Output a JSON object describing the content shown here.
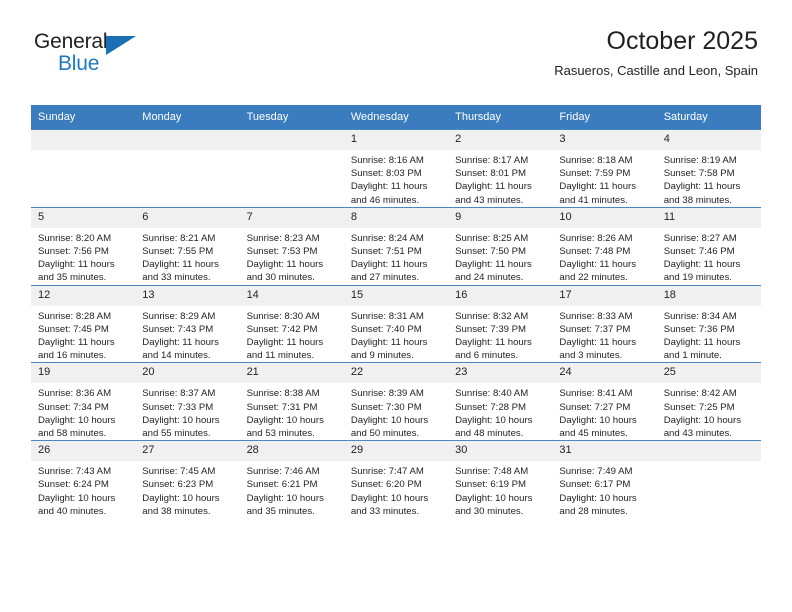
{
  "brand": {
    "name_part1": "General",
    "name_part2": "Blue"
  },
  "header": {
    "title": "October 2025",
    "subtitle": "Rasueros, Castille and Leon, Spain"
  },
  "calendar": {
    "weekday_headers": [
      "Sunday",
      "Monday",
      "Tuesday",
      "Wednesday",
      "Thursday",
      "Friday",
      "Saturday"
    ],
    "accent_color": "#3a7cbe",
    "daynum_bg": "#f0f0f0",
    "weeks": [
      [
        {
          "day": "",
          "empty": true,
          "sunrise": "",
          "sunset": "",
          "daylight1": "",
          "daylight2": ""
        },
        {
          "day": "",
          "empty": true,
          "sunrise": "",
          "sunset": "",
          "daylight1": "",
          "daylight2": ""
        },
        {
          "day": "",
          "empty": true,
          "sunrise": "",
          "sunset": "",
          "daylight1": "",
          "daylight2": ""
        },
        {
          "day": "1",
          "empty": false,
          "sunrise": "Sunrise: 8:16 AM",
          "sunset": "Sunset: 8:03 PM",
          "daylight1": "Daylight: 11 hours",
          "daylight2": "and 46 minutes."
        },
        {
          "day": "2",
          "empty": false,
          "sunrise": "Sunrise: 8:17 AM",
          "sunset": "Sunset: 8:01 PM",
          "daylight1": "Daylight: 11 hours",
          "daylight2": "and 43 minutes."
        },
        {
          "day": "3",
          "empty": false,
          "sunrise": "Sunrise: 8:18 AM",
          "sunset": "Sunset: 7:59 PM",
          "daylight1": "Daylight: 11 hours",
          "daylight2": "and 41 minutes."
        },
        {
          "day": "4",
          "empty": false,
          "sunrise": "Sunrise: 8:19 AM",
          "sunset": "Sunset: 7:58 PM",
          "daylight1": "Daylight: 11 hours",
          "daylight2": "and 38 minutes."
        }
      ],
      [
        {
          "day": "5",
          "empty": false,
          "sunrise": "Sunrise: 8:20 AM",
          "sunset": "Sunset: 7:56 PM",
          "daylight1": "Daylight: 11 hours",
          "daylight2": "and 35 minutes."
        },
        {
          "day": "6",
          "empty": false,
          "sunrise": "Sunrise: 8:21 AM",
          "sunset": "Sunset: 7:55 PM",
          "daylight1": "Daylight: 11 hours",
          "daylight2": "and 33 minutes."
        },
        {
          "day": "7",
          "empty": false,
          "sunrise": "Sunrise: 8:23 AM",
          "sunset": "Sunset: 7:53 PM",
          "daylight1": "Daylight: 11 hours",
          "daylight2": "and 30 minutes."
        },
        {
          "day": "8",
          "empty": false,
          "sunrise": "Sunrise: 8:24 AM",
          "sunset": "Sunset: 7:51 PM",
          "daylight1": "Daylight: 11 hours",
          "daylight2": "and 27 minutes."
        },
        {
          "day": "9",
          "empty": false,
          "sunrise": "Sunrise: 8:25 AM",
          "sunset": "Sunset: 7:50 PM",
          "daylight1": "Daylight: 11 hours",
          "daylight2": "and 24 minutes."
        },
        {
          "day": "10",
          "empty": false,
          "sunrise": "Sunrise: 8:26 AM",
          "sunset": "Sunset: 7:48 PM",
          "daylight1": "Daylight: 11 hours",
          "daylight2": "and 22 minutes."
        },
        {
          "day": "11",
          "empty": false,
          "sunrise": "Sunrise: 8:27 AM",
          "sunset": "Sunset: 7:46 PM",
          "daylight1": "Daylight: 11 hours",
          "daylight2": "and 19 minutes."
        }
      ],
      [
        {
          "day": "12",
          "empty": false,
          "sunrise": "Sunrise: 8:28 AM",
          "sunset": "Sunset: 7:45 PM",
          "daylight1": "Daylight: 11 hours",
          "daylight2": "and 16 minutes."
        },
        {
          "day": "13",
          "empty": false,
          "sunrise": "Sunrise: 8:29 AM",
          "sunset": "Sunset: 7:43 PM",
          "daylight1": "Daylight: 11 hours",
          "daylight2": "and 14 minutes."
        },
        {
          "day": "14",
          "empty": false,
          "sunrise": "Sunrise: 8:30 AM",
          "sunset": "Sunset: 7:42 PM",
          "daylight1": "Daylight: 11 hours",
          "daylight2": "and 11 minutes."
        },
        {
          "day": "15",
          "empty": false,
          "sunrise": "Sunrise: 8:31 AM",
          "sunset": "Sunset: 7:40 PM",
          "daylight1": "Daylight: 11 hours",
          "daylight2": "and 9 minutes."
        },
        {
          "day": "16",
          "empty": false,
          "sunrise": "Sunrise: 8:32 AM",
          "sunset": "Sunset: 7:39 PM",
          "daylight1": "Daylight: 11 hours",
          "daylight2": "and 6 minutes."
        },
        {
          "day": "17",
          "empty": false,
          "sunrise": "Sunrise: 8:33 AM",
          "sunset": "Sunset: 7:37 PM",
          "daylight1": "Daylight: 11 hours",
          "daylight2": "and 3 minutes."
        },
        {
          "day": "18",
          "empty": false,
          "sunrise": "Sunrise: 8:34 AM",
          "sunset": "Sunset: 7:36 PM",
          "daylight1": "Daylight: 11 hours",
          "daylight2": "and 1 minute."
        }
      ],
      [
        {
          "day": "19",
          "empty": false,
          "sunrise": "Sunrise: 8:36 AM",
          "sunset": "Sunset: 7:34 PM",
          "daylight1": "Daylight: 10 hours",
          "daylight2": "and 58 minutes."
        },
        {
          "day": "20",
          "empty": false,
          "sunrise": "Sunrise: 8:37 AM",
          "sunset": "Sunset: 7:33 PM",
          "daylight1": "Daylight: 10 hours",
          "daylight2": "and 55 minutes."
        },
        {
          "day": "21",
          "empty": false,
          "sunrise": "Sunrise: 8:38 AM",
          "sunset": "Sunset: 7:31 PM",
          "daylight1": "Daylight: 10 hours",
          "daylight2": "and 53 minutes."
        },
        {
          "day": "22",
          "empty": false,
          "sunrise": "Sunrise: 8:39 AM",
          "sunset": "Sunset: 7:30 PM",
          "daylight1": "Daylight: 10 hours",
          "daylight2": "and 50 minutes."
        },
        {
          "day": "23",
          "empty": false,
          "sunrise": "Sunrise: 8:40 AM",
          "sunset": "Sunset: 7:28 PM",
          "daylight1": "Daylight: 10 hours",
          "daylight2": "and 48 minutes."
        },
        {
          "day": "24",
          "empty": false,
          "sunrise": "Sunrise: 8:41 AM",
          "sunset": "Sunset: 7:27 PM",
          "daylight1": "Daylight: 10 hours",
          "daylight2": "and 45 minutes."
        },
        {
          "day": "25",
          "empty": false,
          "sunrise": "Sunrise: 8:42 AM",
          "sunset": "Sunset: 7:25 PM",
          "daylight1": "Daylight: 10 hours",
          "daylight2": "and 43 minutes."
        }
      ],
      [
        {
          "day": "26",
          "empty": false,
          "sunrise": "Sunrise: 7:43 AM",
          "sunset": "Sunset: 6:24 PM",
          "daylight1": "Daylight: 10 hours",
          "daylight2": "and 40 minutes."
        },
        {
          "day": "27",
          "empty": false,
          "sunrise": "Sunrise: 7:45 AM",
          "sunset": "Sunset: 6:23 PM",
          "daylight1": "Daylight: 10 hours",
          "daylight2": "and 38 minutes."
        },
        {
          "day": "28",
          "empty": false,
          "sunrise": "Sunrise: 7:46 AM",
          "sunset": "Sunset: 6:21 PM",
          "daylight1": "Daylight: 10 hours",
          "daylight2": "and 35 minutes."
        },
        {
          "day": "29",
          "empty": false,
          "sunrise": "Sunrise: 7:47 AM",
          "sunset": "Sunset: 6:20 PM",
          "daylight1": "Daylight: 10 hours",
          "daylight2": "and 33 minutes."
        },
        {
          "day": "30",
          "empty": false,
          "sunrise": "Sunrise: 7:48 AM",
          "sunset": "Sunset: 6:19 PM",
          "daylight1": "Daylight: 10 hours",
          "daylight2": "and 30 minutes."
        },
        {
          "day": "31",
          "empty": false,
          "sunrise": "Sunrise: 7:49 AM",
          "sunset": "Sunset: 6:17 PM",
          "daylight1": "Daylight: 10 hours",
          "daylight2": "and 28 minutes."
        },
        {
          "day": "",
          "empty": true,
          "sunrise": "",
          "sunset": "",
          "daylight1": "",
          "daylight2": ""
        }
      ]
    ]
  }
}
